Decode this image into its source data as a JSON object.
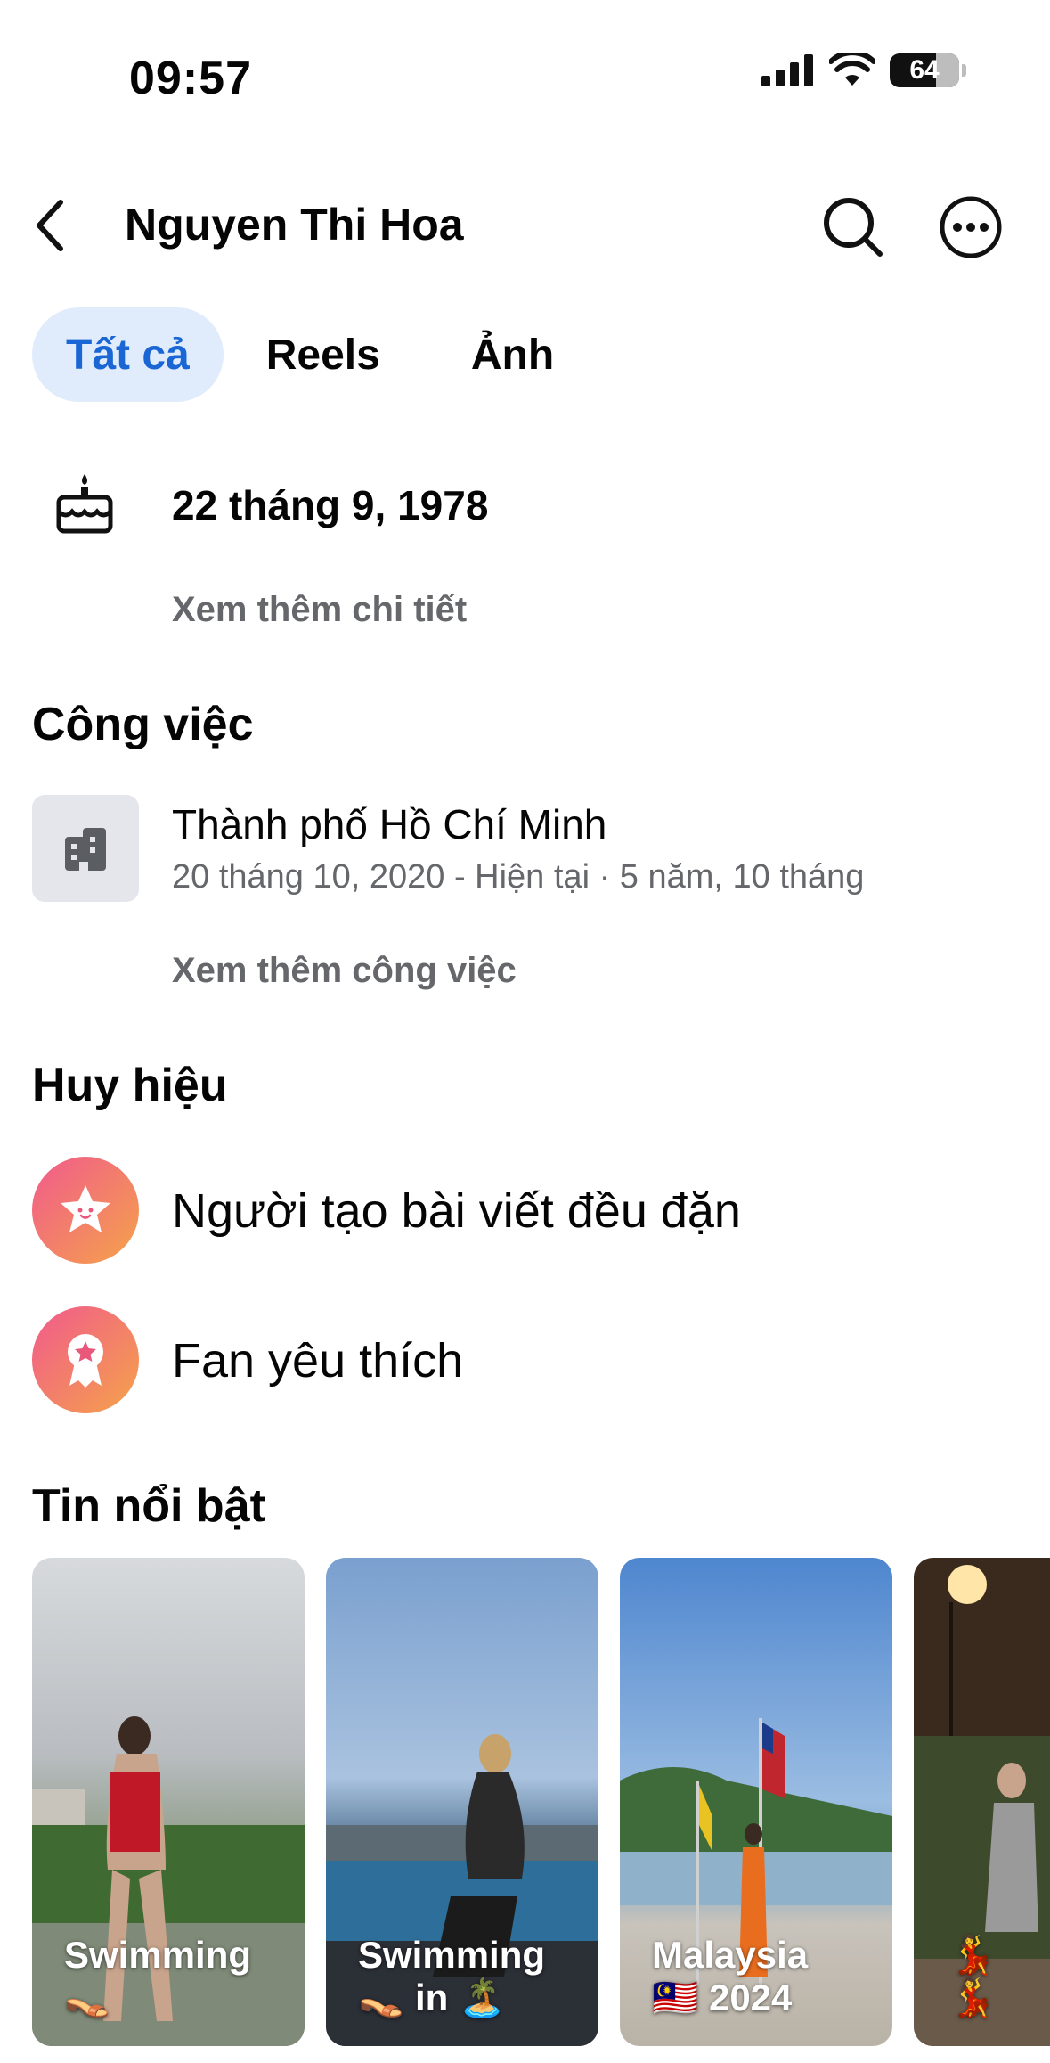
{
  "status": {
    "time": "09:57",
    "battery": "64"
  },
  "header": {
    "title": "Nguyen Thi Hoa"
  },
  "tabs": [
    {
      "label": "Tất cả",
      "active": true
    },
    {
      "label": "Reels",
      "active": false
    },
    {
      "label": "Ảnh",
      "active": false
    }
  ],
  "birthday": {
    "date": "22 tháng 9, 1978",
    "more_link": "Xem thêm chi tiết"
  },
  "work": {
    "section_title": "Công việc",
    "place": "Thành phố Hồ Chí Minh",
    "duration": "20 tháng 10, 2020 - Hiện tại · 5 năm, 10 tháng",
    "more_link": "Xem thêm công việc"
  },
  "badges": {
    "section_title": "Huy hiệu",
    "items": [
      {
        "label": "Người tạo bài viết đều đặn",
        "icon": "star-face-icon"
      },
      {
        "label": "Fan yêu thích",
        "icon": "ribbon-medal-icon"
      }
    ]
  },
  "highlights": {
    "section_title": "Tin nổi bật",
    "items": [
      {
        "line1": "Swimming",
        "line2": "👡"
      },
      {
        "line1": "Swimming",
        "line2": "👡 in 🏝️"
      },
      {
        "line1": "Malaysia",
        "line2": "🇲🇾 2024"
      },
      {
        "line1": "",
        "line2": "💃 💃"
      }
    ]
  },
  "colors": {
    "accent": "#1a66d4",
    "tab_active_bg": "#e0ecfb",
    "muted_text": "#65676b",
    "icon_bg": "#e4e6eb"
  }
}
